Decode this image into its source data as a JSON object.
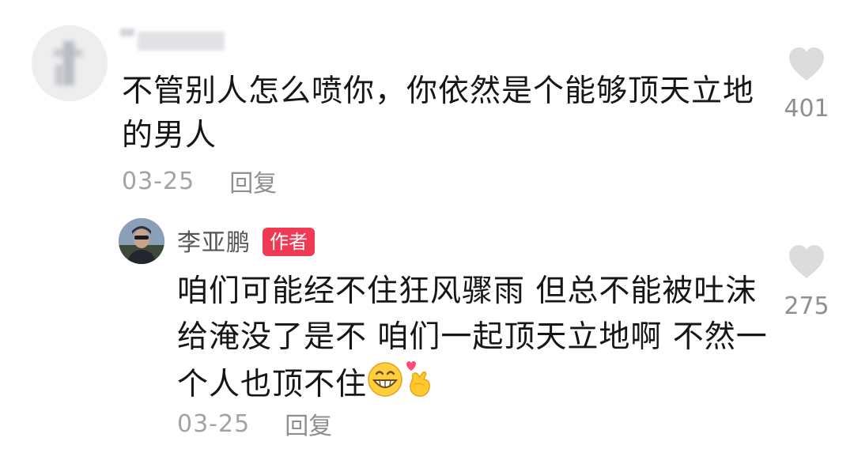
{
  "comment": {
    "text": "不管别人怎么喷你，你依然是个能够顶天立地的男人",
    "date": "03-25",
    "reply_label": "回复",
    "likes": "401"
  },
  "author_reply": {
    "username": "李亚鹏",
    "badge": "作者",
    "text": "咱们可能经不住狂风骤雨 但总不能被吐沫给淹没了是不 咱们一起顶天立地啊 不然一个人也顶不住",
    "emojis": [
      "grinning-face-emoji",
      "finger-heart-emoji"
    ],
    "date": "03-25",
    "reply_label": "回复",
    "likes": "275"
  },
  "colors": {
    "badge": "#f03a53",
    "meta_text": "#8e8e93",
    "heart": "#dcdcdc",
    "body_text": "#161616"
  }
}
